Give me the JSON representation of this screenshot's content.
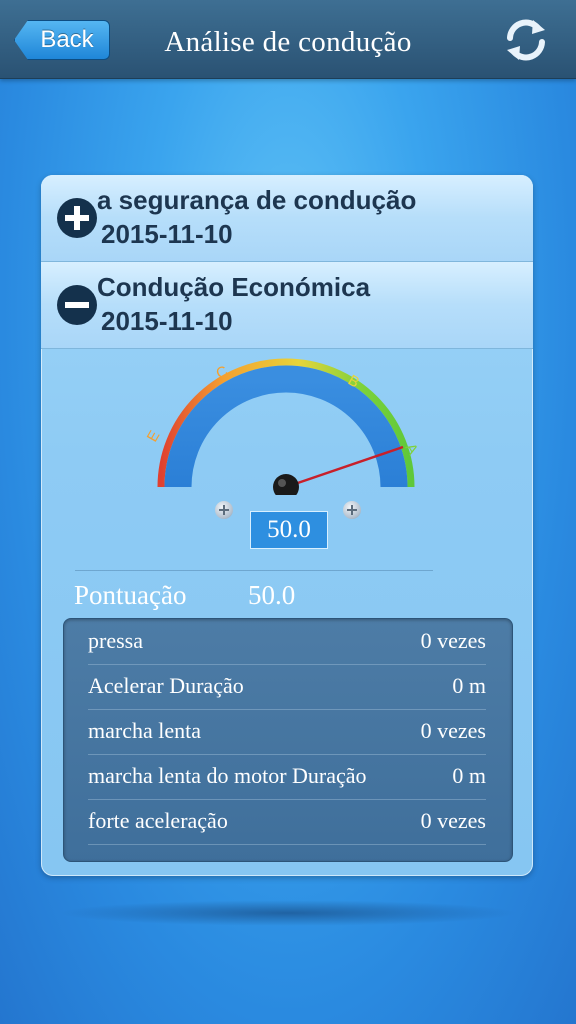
{
  "header": {
    "back_label": "Back",
    "title": "Análise de condução",
    "refresh_icon": "refresh-icon"
  },
  "sections": [
    {
      "title": "a segurança de condução",
      "date": "2015-11-10",
      "state": "collapsed",
      "toggle_icon": "plus-circle-icon"
    },
    {
      "title": "Condução Económica",
      "date": "2015-11-10",
      "state": "expanded",
      "toggle_icon": "minus-circle-icon"
    }
  ],
  "gauge": {
    "grades": [
      "E",
      "C",
      "B",
      "A"
    ],
    "value": 50.0,
    "display": "50.0",
    "colors": {
      "red": "#e04030",
      "orange": "#f4a030",
      "yellow": "#e8d43a",
      "green": "#7ed23a",
      "needle": "#c8202a"
    }
  },
  "score": {
    "label": "Pontuação",
    "value": "50.0"
  },
  "stats": [
    {
      "label": "pressa",
      "value": "0 vezes"
    },
    {
      "label": "Acelerar Duração",
      "value": "0 m"
    },
    {
      "label": "marcha lenta",
      "value": "0 vezes"
    },
    {
      "label": "marcha lenta do motor Duração",
      "value": "0 m"
    },
    {
      "label": "forte aceleração",
      "value": "0 vezes"
    }
  ]
}
